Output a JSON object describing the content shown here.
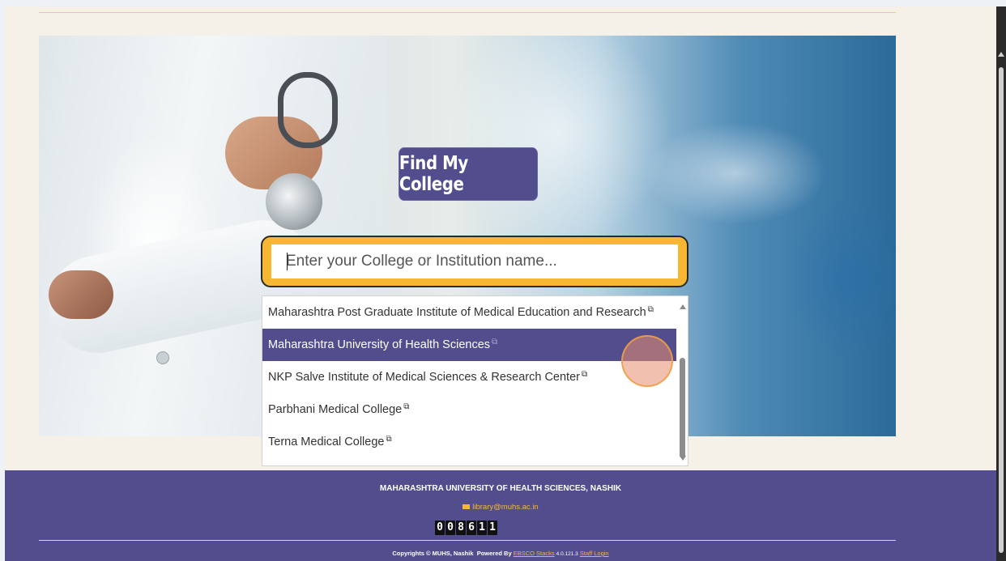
{
  "hero": {
    "find_button_label": "Find My College"
  },
  "search": {
    "placeholder": "Enter your College or Institution name..."
  },
  "dropdown": {
    "ext_icon": "external-link-icon",
    "items": [
      {
        "label": "Maharashtra Post Graduate Institute of Medical Education and Research",
        "selected": false
      },
      {
        "label": "Maharashtra University of Health Sciences",
        "selected": true
      },
      {
        "label": "NKP Salve Institute of Medical Sciences & Research Center",
        "selected": false
      },
      {
        "label": "Parbhani Medical College",
        "selected": false
      },
      {
        "label": "Terna Medical College",
        "selected": false
      }
    ]
  },
  "footer": {
    "title": "MAHARASHTRA UNIVERSITY OF HEALTH SCIENCES, NASHIK",
    "email": "library@muhs.ac.in",
    "counter_digits": [
      "0",
      "0",
      "8",
      "6",
      "1",
      "1"
    ],
    "copyright": "Copyrights © MUHS, Nashik",
    "powered_by": "Powered By",
    "powered_link": "EBSCO Stacks",
    "version": "4.0.121.3",
    "staff_login": "Staff Login"
  },
  "colors": {
    "brand": "#524e8e",
    "accent": "#f7b733"
  }
}
